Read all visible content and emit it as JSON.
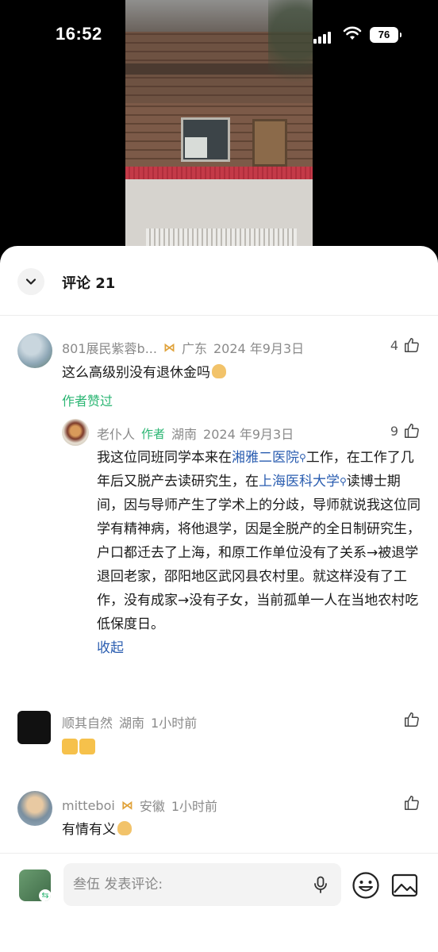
{
  "status_bar": {
    "time": "16:52",
    "battery": "76"
  },
  "sheet": {
    "title": "评论 21"
  },
  "comments": [
    {
      "user": "801展民紫蓉b...",
      "location": "广东",
      "date": "2024 年9月3日",
      "likes": "4",
      "text": "这么高级别没有退休金吗",
      "liked_by_author": "作者赞过"
    },
    {
      "user": "老仆人",
      "author_tag": "作者",
      "location": "湖南",
      "date": "2024 年9月3日",
      "likes": "9",
      "text_parts": {
        "p1": "我这位同班同学本来在",
        "link1": "湘雅二医院",
        "p2": "工作，在工作了几年后又脱产去读研究生，在",
        "link2": "上海医科大学",
        "p3": "读博士期间，因与导师产生了学术上的分歧，导师就说我这位同学有精神病，将他退学，因是全脱产的全日制研究生，户口都迁去了上海，和原工作单位没有了关系→被退学退回老家，邵阳地区武冈县农村里。就这样没有了工作，没有成家→没有子女，当前孤单一人在当地农村吃低保度日。"
      },
      "fold_label": "收起"
    },
    {
      "user": "顺其自然",
      "location": "湖南",
      "time": "1小时前",
      "likes": ""
    },
    {
      "user": "mitteboi",
      "location": "安徽",
      "time": "1小时前",
      "likes": "",
      "text": "有情有义"
    }
  ],
  "input_bar": {
    "placeholder": "叁伍 发表评论:"
  },
  "colors": {
    "author_green": "#2bb673",
    "link_blue": "#2a5db0",
    "meta_gray": "#8a8a8a"
  }
}
